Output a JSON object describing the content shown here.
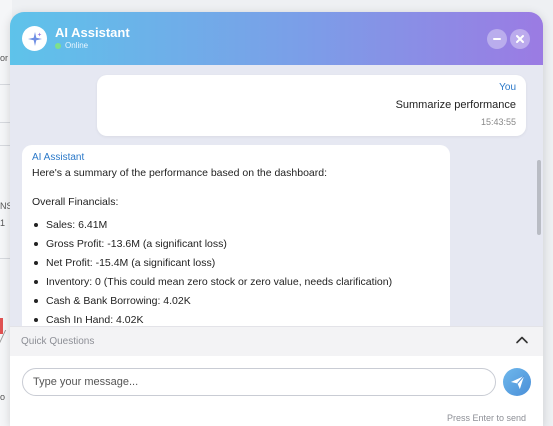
{
  "background_fragments": [
    "or",
    "NS",
    "1",
    "o"
  ],
  "header": {
    "title": "AI Assistant",
    "status": "Online"
  },
  "messages": {
    "user": {
      "sender": "You",
      "text": "Summarize performance",
      "time": "15:43:55"
    },
    "assistant": {
      "sender": "AI Assistant",
      "intro": "Here's a summary of the performance based on the dashboard:",
      "section": "Overall Financials:",
      "items": [
        "Sales: 6.41M",
        "Gross Profit: -13.6M (a significant loss)",
        "Net Profit: -15.4M (a significant loss)",
        "Inventory: 0 (This could mean zero stock or zero value, needs clarification)",
        "Cash & Bank Borrowing: 4.02K",
        "Cash In Hand: 4.02K"
      ]
    }
  },
  "quick_questions": {
    "label": "Quick Questions"
  },
  "composer": {
    "placeholder": "Type your message...",
    "hint": "Press Enter to send"
  },
  "icons": {
    "avatar": "sparkle-icon",
    "minimize": "minus-icon",
    "close": "close-icon",
    "quick_toggle": "chevron-up-icon",
    "send": "paper-plane-icon"
  },
  "colors": {
    "header_start": "#5ec3ea",
    "header_end": "#9b7be3",
    "sender_label": "#2a78c8",
    "status_dot": "#7fe08a",
    "send_button": "#4a8fd8"
  }
}
